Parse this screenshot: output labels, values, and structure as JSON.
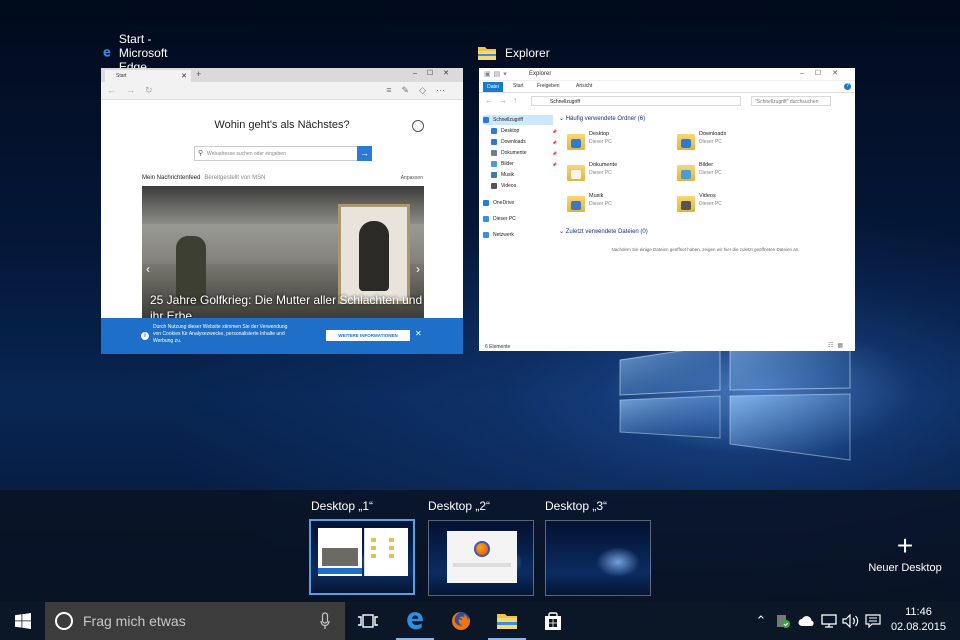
{
  "windows": [
    {
      "title": "Start - Microsoft Edge",
      "icon": "edge-icon",
      "tab_label": "Start",
      "heading": "Wohin geht's als Nächstes?",
      "search_placeholder": "Webadresse suchen oder eingeben",
      "feed_title": "Mein Nachrichtenfeed",
      "feed_sub": "Bereitgestellt von MSN",
      "feed_adjust": "Anpassen",
      "headline": "25 Jahre Golfkrieg: Die Mutter aller Schlachten und ihr Erbe",
      "cookie_text": "Durch Nutzung dieser Website stimmen Sie der Verwendung von Cookies für Analysezwecke, personalisierte Inhalte und Werbung zu.",
      "cookie_button": "WEITERE INFORMATIONEN"
    },
    {
      "title": "Explorer",
      "icon": "folder-icon",
      "window_title": "Explorer",
      "ribbon_tabs": [
        "Datei",
        "Start",
        "Freigeben",
        "Ansicht"
      ],
      "path": "Schnellzugriff",
      "search_placeholder": "\"Schnellzugriff\" durchsuchen",
      "sidebar": [
        {
          "label": "Schnellzugriff",
          "color": "#2a7bd6",
          "pinned": false,
          "selected": true
        },
        {
          "label": "Desktop",
          "color": "#2a7bd6",
          "pinned": true,
          "selected": false
        },
        {
          "label": "Downloads",
          "color": "#2a7bd6",
          "pinned": true,
          "selected": false
        },
        {
          "label": "Dokumente",
          "color": "#6e7e8e",
          "pinned": true,
          "selected": false
        },
        {
          "label": "Bilder",
          "color": "#4a9bd9",
          "pinned": true,
          "selected": false
        },
        {
          "label": "Musik",
          "color": "#3b78c2",
          "pinned": false,
          "selected": false
        },
        {
          "label": "Videos",
          "color": "#555555",
          "pinned": false,
          "selected": false
        },
        {
          "label": "OneDrive",
          "color": "#2a7bd6",
          "pinned": false,
          "selected": false
        },
        {
          "label": "Dieser PC",
          "color": "#3a8fd8",
          "pinned": false,
          "selected": false
        },
        {
          "label": "Netzwerk",
          "color": "#3a8fd8",
          "pinned": false,
          "selected": false
        }
      ],
      "frequent_header": "Häufig verwendete Ordner (6)",
      "folders": [
        {
          "name": "Desktop",
          "location": "Dieser PC",
          "badge": "#2a7bd6"
        },
        {
          "name": "Downloads",
          "location": "Dieser PC",
          "badge": "#2a7bd6"
        },
        {
          "name": "Dokumente",
          "location": "Dieser PC",
          "badge": "#f4f4f4"
        },
        {
          "name": "Bilder",
          "location": "Dieser PC",
          "badge": "#4a9bd9"
        },
        {
          "name": "Musik",
          "location": "Dieser PC",
          "badge": "#3b78c2"
        },
        {
          "name": "Videos",
          "location": "Dieser PC",
          "badge": "#555555"
        }
      ],
      "recent_header": "Zuletzt verwendete Dateien (0)",
      "recent_message": "Nachdem Sie einige Dateien geöffnet haben, zeigen wir hier die zuletzt geöffneten Dateien an.",
      "status": "6 Elemente"
    }
  ],
  "desktops": [
    {
      "label": "Desktop „1“",
      "active": true
    },
    {
      "label": "Desktop „2“",
      "active": false
    },
    {
      "label": "Desktop „3“",
      "active": false
    }
  ],
  "new_desktop_label": "Neuer Desktop",
  "taskbar": {
    "search_placeholder": "Frag mich etwas",
    "pinned": [
      "task-view-icon",
      "edge-icon",
      "firefox-icon",
      "file-explorer-icon",
      "store-icon"
    ],
    "tray": [
      "chevron-up-icon",
      "defender-icon",
      "onedrive-icon",
      "network-icon",
      "volume-icon",
      "action-center-icon"
    ],
    "time": "11:46",
    "date": "02.08.2015"
  },
  "colors": {
    "accent": "#1d6fc7",
    "taskbar": "#0b1626",
    "explorer_blue": "#1979ca"
  }
}
